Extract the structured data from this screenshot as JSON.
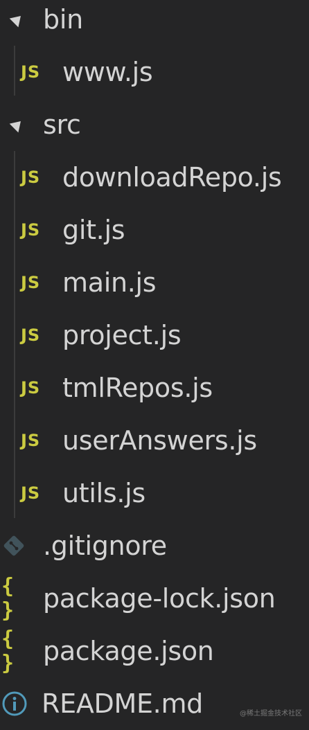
{
  "explorer": {
    "items": [
      {
        "label": "bin",
        "type": "folder"
      },
      {
        "label": "www.js",
        "type": "js"
      },
      {
        "label": "src",
        "type": "folder"
      },
      {
        "label": "downloadRepo.js",
        "type": "js"
      },
      {
        "label": "git.js",
        "type": "js"
      },
      {
        "label": "main.js",
        "type": "js"
      },
      {
        "label": "project.js",
        "type": "js"
      },
      {
        "label": "tmlRepos.js",
        "type": "js"
      },
      {
        "label": "userAnswers.js",
        "type": "js"
      },
      {
        "label": "utils.js",
        "type": "js"
      },
      {
        "label": ".gitignore",
        "type": "git"
      },
      {
        "label": "package-lock.json",
        "type": "json"
      },
      {
        "label": "package.json",
        "type": "json"
      },
      {
        "label": "README.md",
        "type": "info"
      }
    ]
  },
  "icons": {
    "js_text": "JS",
    "json_text": "{ }"
  },
  "colors": {
    "background": "#252526",
    "text": "#d4d4d4",
    "js_icon": "#cbcb41",
    "json_icon": "#cbcb41",
    "git_icon": "#41535b",
    "info_icon": "#519aba"
  },
  "watermark": "@稀土掘金技术社区"
}
